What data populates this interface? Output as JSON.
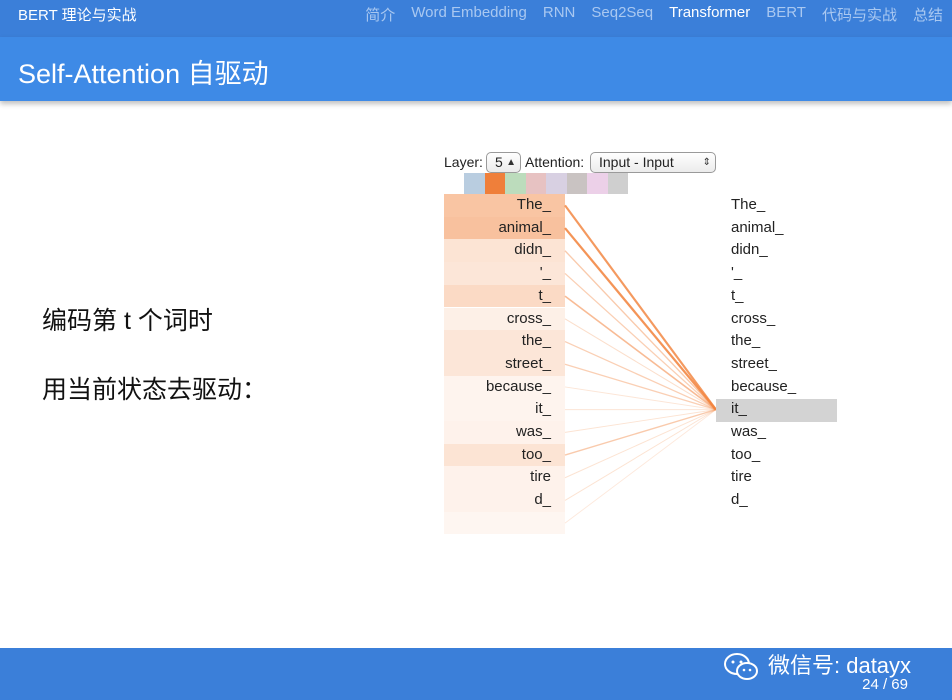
{
  "header": {
    "doc_title": "BERT 理论与实战",
    "nav": [
      {
        "label": "简介",
        "active": false
      },
      {
        "label": "Word Embedding",
        "active": false
      },
      {
        "label": "RNN",
        "active": false
      },
      {
        "label": "Seq2Seq",
        "active": false
      },
      {
        "label": "Transformer",
        "active": true
      },
      {
        "label": "BERT",
        "active": false
      },
      {
        "label": "代码与实战",
        "active": false
      },
      {
        "label": "总结",
        "active": false
      }
    ]
  },
  "frame_title": "Self-Attention 自驱动",
  "body": {
    "line1": "编码第 t 个词时",
    "line2": "用当前状态去驱动："
  },
  "viz": {
    "layer_label": "Layer:",
    "layer_value": "5",
    "attention_label": "Attention:",
    "attention_value": "Input - Input",
    "head_colors": [
      "#b9cde0",
      "#ef7f3a",
      "#bcdcbc",
      "#e7c2c2",
      "#d8d0e2",
      "#c9c3c2",
      "#ecd0e8",
      "#cfcfcf"
    ],
    "line_color": "#f2843e",
    "selected_right_index": 9,
    "tokens_left": [
      "The_",
      "animal_",
      "didn_",
      "'_",
      "t_",
      "cross_",
      "the_",
      "street_",
      "because_",
      "it_",
      "was_",
      "too_",
      "tire",
      "d_",
      ""
    ],
    "tokens_right": [
      "The_",
      "animal_",
      "didn_",
      "'_",
      "t_",
      "cross_",
      "the_",
      "street_",
      "because_",
      "it_",
      "was_",
      "too_",
      "tire",
      "d_"
    ],
    "weights": [
      0.85,
      0.9,
      0.35,
      0.3,
      0.5,
      0.15,
      0.3,
      0.3,
      0.08,
      0.08,
      0.1,
      0.35,
      0.1,
      0.1,
      0.05
    ]
  },
  "footer": {
    "watermark": "微信号: datayx",
    "page": "24 / 69"
  }
}
